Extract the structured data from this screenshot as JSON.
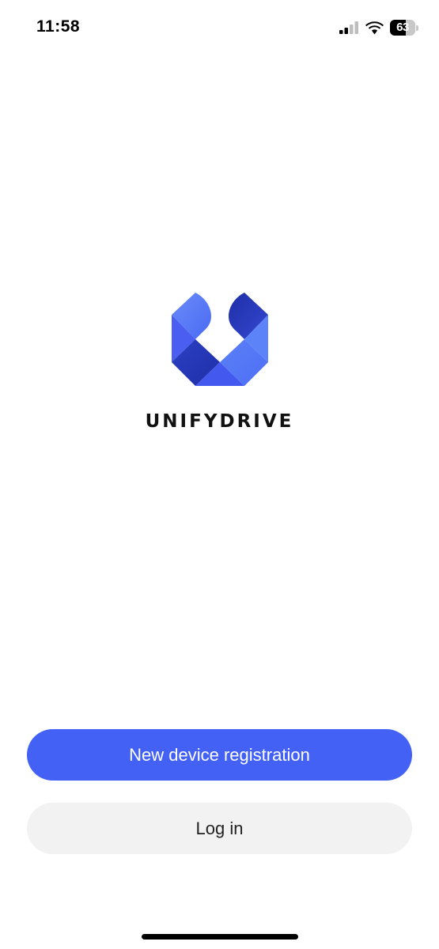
{
  "status_bar": {
    "time": "11:58",
    "battery_level": "63",
    "battery_fraction": 0.63,
    "signal_icon": "cellular-signal-icon",
    "wifi_icon": "wifi-icon"
  },
  "brand": {
    "name": "UNIFYDRIVE",
    "logo_icon": "unifydrive-logo-icon",
    "colors": {
      "light_blue": "#5b82f7",
      "mid_blue": "#4a5ef2",
      "dark_blue": "#2638b8",
      "navy": "#1c2aa6"
    }
  },
  "actions": {
    "primary_label": "New device registration",
    "secondary_label": "Log in",
    "primary_color": "#4361f5",
    "secondary_color": "#f2f2f2"
  }
}
